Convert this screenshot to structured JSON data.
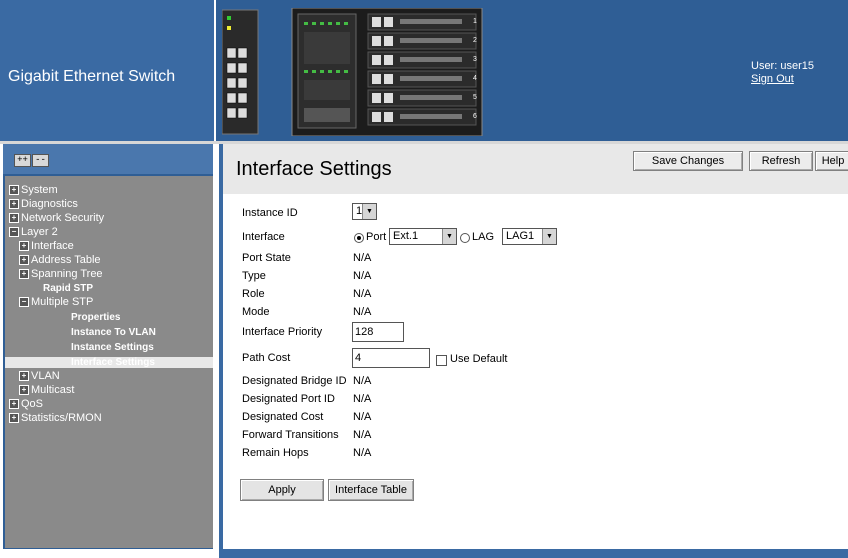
{
  "header": {
    "brand": "Gigabit Ethernet Switch",
    "user_line": "User: user15",
    "signout": "Sign Out",
    "device_ports": [
      "1",
      "2",
      "3",
      "4",
      "5",
      "6"
    ]
  },
  "tree_controls": {
    "expand": "++",
    "collapse": "--"
  },
  "tree": [
    {
      "label": "System",
      "indent": 0,
      "kind": "plus"
    },
    {
      "label": "Diagnostics",
      "indent": 0,
      "kind": "plus"
    },
    {
      "label": "Network Security",
      "indent": 0,
      "kind": "plus"
    },
    {
      "label": "Layer 2",
      "indent": 0,
      "kind": "minus"
    },
    {
      "label": "Interface",
      "indent": 1,
      "kind": "plus"
    },
    {
      "label": "Address Table",
      "indent": 1,
      "kind": "plus"
    },
    {
      "label": "Spanning Tree",
      "indent": 1,
      "kind": "plus"
    },
    {
      "label": "Rapid STP",
      "indent": 2,
      "kind": "leaf"
    },
    {
      "label": "Multiple STP",
      "indent": 1,
      "kind": "minus"
    },
    {
      "label": "Properties",
      "indent": 3,
      "kind": "leaf"
    },
    {
      "label": "Instance To VLAN",
      "indent": 3,
      "kind": "leaf"
    },
    {
      "label": "Instance Settings",
      "indent": 3,
      "kind": "leaf"
    },
    {
      "label": "Interface Settings",
      "indent": 3,
      "kind": "leaf",
      "selected": true
    },
    {
      "label": "VLAN",
      "indent": 1,
      "kind": "plus"
    },
    {
      "label": "Multicast",
      "indent": 1,
      "kind": "plus"
    },
    {
      "label": "QoS",
      "indent": 0,
      "kind": "plus"
    },
    {
      "label": "Statistics/RMON",
      "indent": 0,
      "kind": "plus"
    }
  ],
  "page": {
    "title": "Interface Settings",
    "save_changes": "Save Changes",
    "refresh": "Refresh",
    "help": "Help"
  },
  "form": {
    "instance_id_label": "Instance ID",
    "instance_id_value": "1",
    "interface_label": "Interface",
    "port_label": "Port",
    "port_value": "Ext.1",
    "lag_label": "LAG",
    "lag_value": "LAG1",
    "port_state_label": "Port State",
    "port_state_value": "N/A",
    "type_label": "Type",
    "type_value": "N/A",
    "role_label": "Role",
    "role_value": "N/A",
    "mode_label": "Mode",
    "mode_value": "N/A",
    "priority_label": "Interface Priority",
    "priority_value": "128",
    "path_cost_label": "Path Cost",
    "path_cost_value": "4",
    "use_default_label": "Use Default",
    "bridge_id_label": "Designated Bridge ID",
    "bridge_id_value": "N/A",
    "port_id_label": "Designated Port ID",
    "port_id_value": "N/A",
    "cost_label": "Designated Cost",
    "cost_value": "N/A",
    "transitions_label": "Forward Transitions",
    "transitions_value": "N/A",
    "hops_label": "Remain Hops",
    "hops_value": "N/A",
    "apply": "Apply",
    "interface_table": "Interface Table"
  },
  "colors": {
    "header_bg": "#2f5e95",
    "tree_bg": "#8a8a8a",
    "title_bar": "#e8e8e8"
  }
}
